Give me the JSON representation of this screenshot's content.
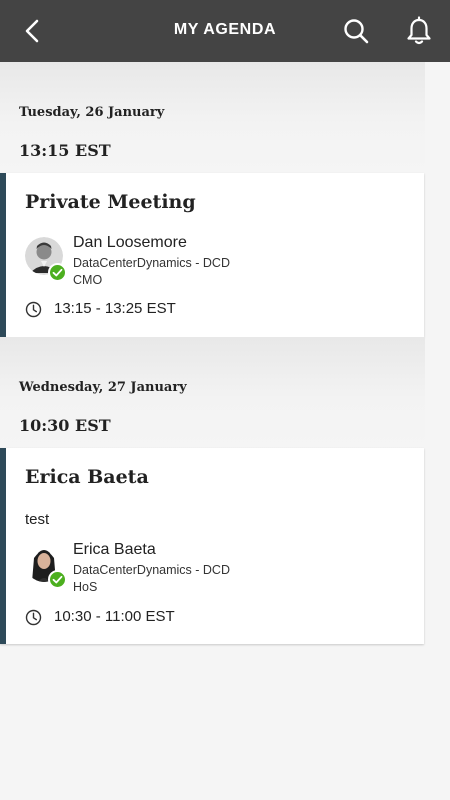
{
  "header": {
    "title": "MY AGENDA",
    "back_icon": "chevron-left-icon",
    "search_icon": "search-icon",
    "notification_icon": "bell-icon",
    "background": "#444444"
  },
  "days": [
    {
      "date": "Tuesday, 26 January",
      "time": "13:15 EST",
      "meeting": {
        "title": "Private Meeting",
        "description": "",
        "person": {
          "name": "Dan Loosemore",
          "company": "DataCenterDynamics - DCD",
          "role": "CMO"
        },
        "time_range": "13:15 - 13:25 EST"
      }
    },
    {
      "date": "Wednesday, 27 January",
      "time": "10:30 EST",
      "meeting": {
        "title": "Erica Baeta",
        "description": "test",
        "person": {
          "name": "Erica Baeta",
          "company": "DataCenterDynamics - DCD",
          "role": "HoS"
        },
        "time_range": "10:30 - 11:00 EST"
      }
    }
  ],
  "colors": {
    "accent_border": "#2e4a59",
    "confirmed_badge": "#4caf1f"
  }
}
